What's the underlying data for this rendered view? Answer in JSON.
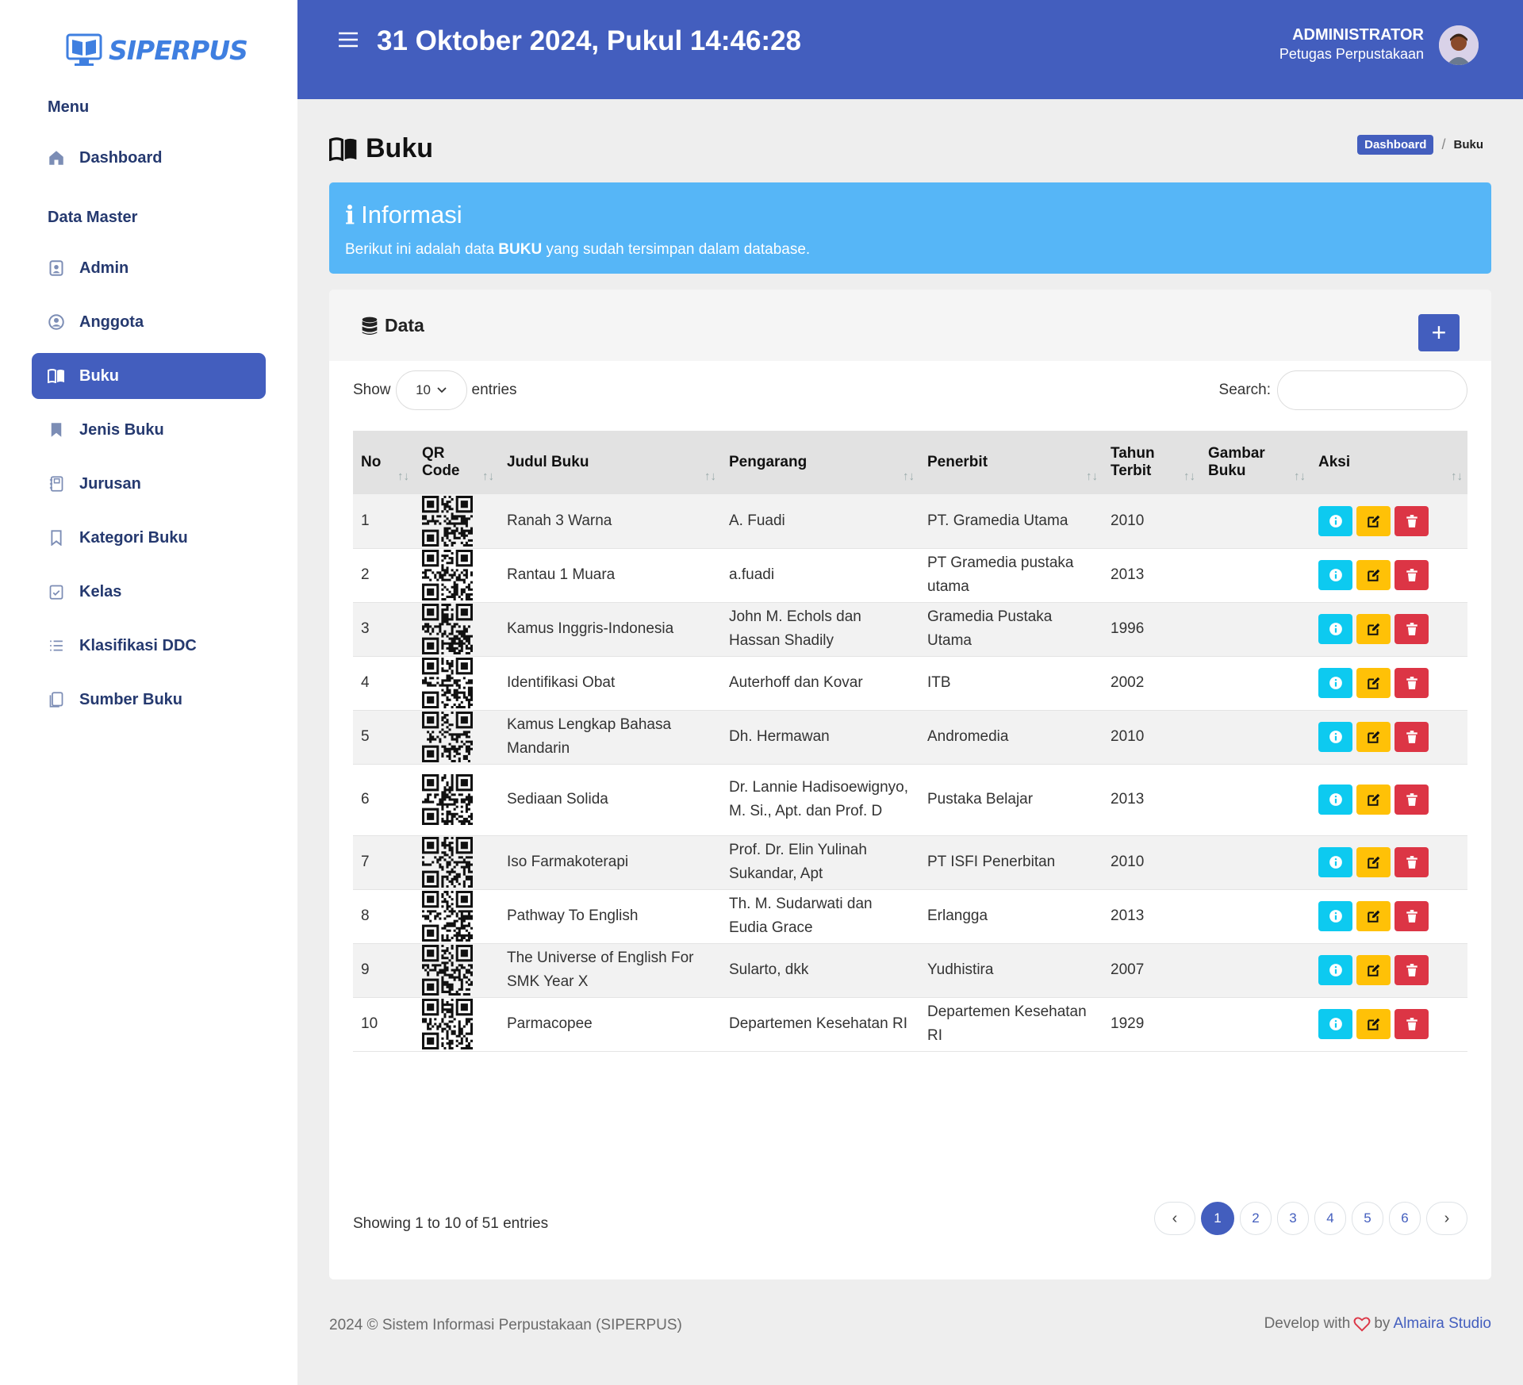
{
  "app": {
    "logo_text": "SIPERPUS"
  },
  "sidebar": {
    "menu_heading": "Menu",
    "master_heading": "Data Master",
    "items": [
      {
        "label": "Dashboard",
        "icon": "house-icon"
      },
      {
        "label": "Admin",
        "icon": "person-badge-icon"
      },
      {
        "label": "Anggota",
        "icon": "person-circle-icon"
      },
      {
        "label": "Buku",
        "icon": "book-open-icon",
        "active": true
      },
      {
        "label": "Jenis Buku",
        "icon": "bookmark-fill-icon"
      },
      {
        "label": "Jurusan",
        "icon": "journal-icon"
      },
      {
        "label": "Kategori Buku",
        "icon": "bookmark-outline-icon"
      },
      {
        "label": "Kelas",
        "icon": "calendar-check-icon"
      },
      {
        "label": "Klasifikasi DDC",
        "icon": "list-icon"
      },
      {
        "label": "Sumber Buku",
        "icon": "journals-icon"
      }
    ]
  },
  "topbar": {
    "datetime": "31 Oktober 2024, Pukul 14:46:28",
    "user_name": "ADMINISTRATOR",
    "user_role": "Petugas Perpustakaan"
  },
  "page": {
    "title": "Buku",
    "breadcrumb": {
      "link": "Dashboard",
      "separator": "/",
      "current": "Buku"
    }
  },
  "alert": {
    "title": "Informasi",
    "text_before": "Berikut ini adalah data ",
    "text_bold": "BUKU",
    "text_after": " yang sudah tersimpan dalam database."
  },
  "card": {
    "title": "Data",
    "add_label": "+",
    "show_label": "Show",
    "entries_value": "10",
    "entries_label": "entries",
    "search_label": "Search:",
    "search_value": ""
  },
  "table": {
    "columns": [
      {
        "line1": "No",
        "line2": ""
      },
      {
        "line1": "QR",
        "line2": "Code"
      },
      {
        "line1": "Judul Buku",
        "line2": ""
      },
      {
        "line1": "Pengarang",
        "line2": ""
      },
      {
        "line1": "Penerbit",
        "line2": ""
      },
      {
        "line1": "Tahun",
        "line2": "Terbit"
      },
      {
        "line1": "Gambar",
        "line2": "Buku"
      },
      {
        "line1": "Aksi",
        "line2": ""
      }
    ],
    "sort_glyph": "↑↓",
    "rows": [
      {
        "no": "1",
        "judul": "Ranah 3 Warna",
        "pengarang": "A. Fuadi",
        "penerbit": "PT. Gramedia Utama",
        "tahun": "2010",
        "gambar": ""
      },
      {
        "no": "2",
        "judul": "Rantau 1 Muara",
        "pengarang": "a.fuadi",
        "penerbit": "PT Gramedia pustaka utama",
        "tahun": "2013",
        "gambar": ""
      },
      {
        "no": "3",
        "judul": "Kamus Inggris-Indonesia",
        "pengarang": "John M. Echols dan Hassan Shadily",
        "penerbit": "Gramedia Pustaka Utama",
        "tahun": "1996",
        "gambar": ""
      },
      {
        "no": "4",
        "judul": "Identifikasi Obat",
        "pengarang": "Auterhoff dan Kovar",
        "penerbit": "ITB",
        "tahun": "2002",
        "gambar": ""
      },
      {
        "no": "5",
        "judul": "Kamus Lengkap Bahasa Mandarin",
        "pengarang": "Dh. Hermawan",
        "penerbit": "Andromedia",
        "tahun": "2010",
        "gambar": ""
      },
      {
        "no": "6",
        "judul": "Sediaan Solida",
        "pengarang": "Dr. Lannie Hadisoewignyo, M. Si., Apt. dan Prof. D",
        "penerbit": "Pustaka Belajar",
        "tahun": "2013",
        "gambar": ""
      },
      {
        "no": "7",
        "judul": "Iso Farmakoterapi",
        "pengarang": "Prof. Dr. Elin Yulinah Sukandar, Apt",
        "penerbit": "PT ISFI Penerbitan",
        "tahun": "2010",
        "gambar": ""
      },
      {
        "no": "8",
        "judul": "Pathway To English",
        "pengarang": "Th. M. Sudarwati dan Eudia Grace",
        "penerbit": "Erlangga",
        "tahun": "2013",
        "gambar": ""
      },
      {
        "no": "9",
        "judul": "The Universe of English For SMK Year X",
        "pengarang": "Sularto, dkk",
        "penerbit": "Yudhistira",
        "tahun": "2007",
        "gambar": ""
      },
      {
        "no": "10",
        "judul": "Parmacopee",
        "pengarang": "Departemen Kesehatan RI",
        "penerbit": "Departemen Kesehatan RI",
        "tahun": "1929",
        "gambar": ""
      }
    ]
  },
  "pagination": {
    "info": "Showing 1 to 10 of 51 entries",
    "prev": "‹",
    "next": "›",
    "pages": [
      "1",
      "2",
      "3",
      "4",
      "5",
      "6"
    ],
    "current": "1"
  },
  "footer": {
    "left": "2024 © Sistem Informasi Perpustakaan (SIPERPUS)",
    "right_before": "Develop with",
    "right_by": "by",
    "right_studio": "Almaira Studio"
  },
  "colors": {
    "primary": "#435ebe",
    "info_alert": "#56b6f7",
    "btn_info": "#0dcaf0",
    "btn_edit": "#ffc107",
    "btn_delete": "#dc3545"
  }
}
